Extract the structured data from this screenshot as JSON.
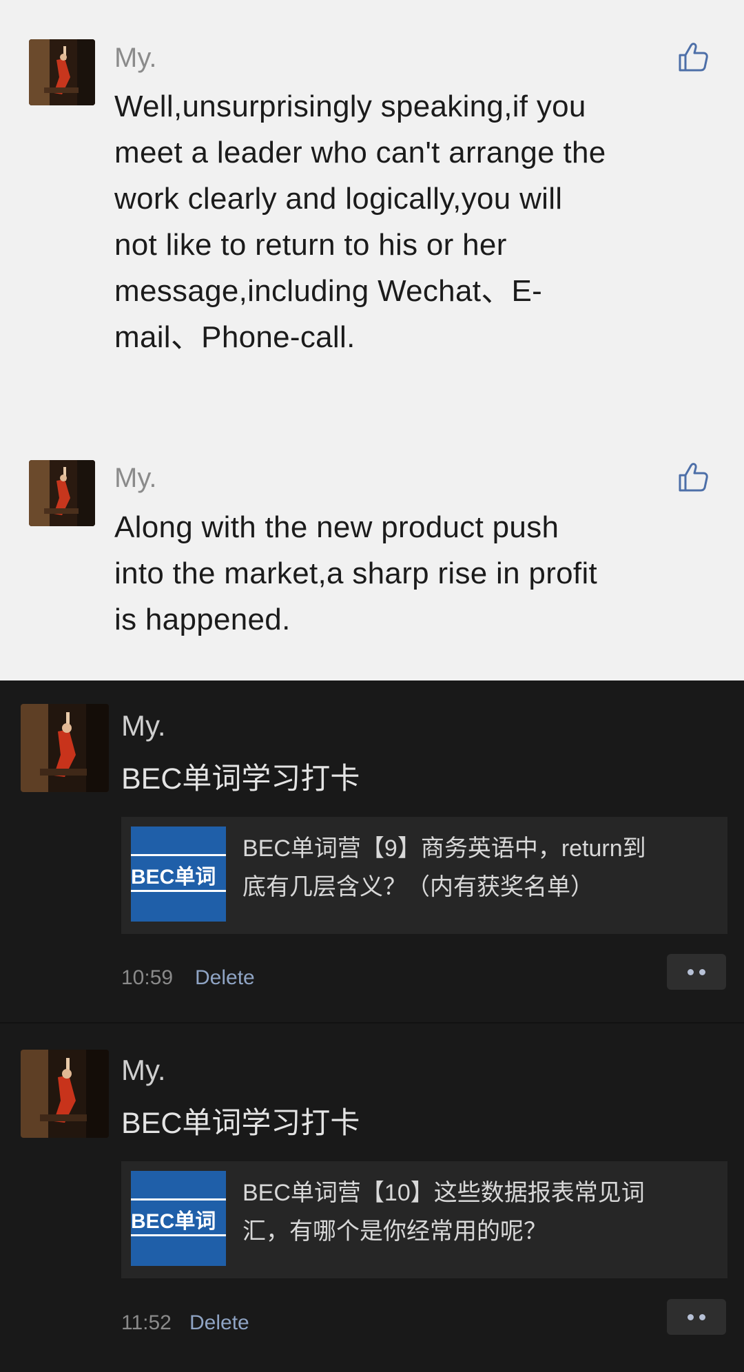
{
  "comments": [
    {
      "author": "My.",
      "text": "Well,unsurprisingly speaking,if you\nmeet a leader who can't arrange the\nwork clearly and logically,you will\nnot like to return to his or her\nmessage,including Wechat、E-\nmail、Phone-call.",
      "like_icon": "thumbs-up-icon"
    },
    {
      "author": "My.",
      "text": "Along with the new product push\ninto the market,a sharp rise in profit\nis happened.",
      "like_icon": "thumbs-up-icon"
    }
  ],
  "posts": [
    {
      "author": "My.",
      "text": "BEC单词学习打卡",
      "link": {
        "thumb_text": "BEC单词",
        "title_line1": "BEC单词营【9】商务英语中，return到",
        "title_line2": "底有几层含义？（内有获奖名单）"
      },
      "time": "10:59",
      "delete_label": "Delete",
      "more_icon": "more-dots-icon"
    },
    {
      "author": "My.",
      "text": "BEC单词学习打卡",
      "link": {
        "thumb_text": "BEC单词",
        "title_line1": "BEC单词营【10】这些数据报表常见词",
        "title_line2": "汇，有哪个是你经常用的呢？"
      },
      "time": "11:52",
      "delete_label": "Delete",
      "more_icon": "more-dots-icon"
    }
  ],
  "colors": {
    "light_bg": "#f1f1f1",
    "dark_bg": "#191919",
    "link_blue": "#8fa4c4",
    "thumb_blue": "#1f5fa9"
  }
}
